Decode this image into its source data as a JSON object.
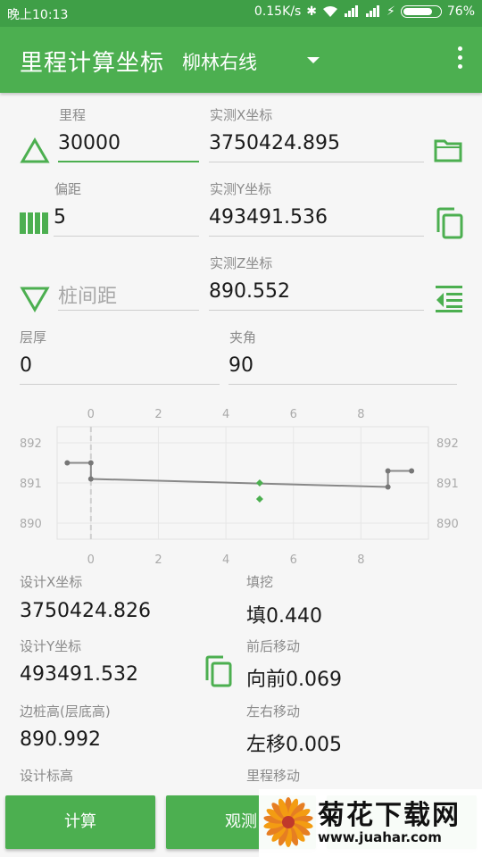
{
  "status_bar": {
    "time": "晚上10:13",
    "speed": "0.15K/s",
    "battery": "76%"
  },
  "app_bar": {
    "title": "里程计算坐标",
    "line": "柳林右线"
  },
  "fields": {
    "mileage_label": "里程",
    "mileage": "30000",
    "x_label": "实测X坐标",
    "x": "3750424.895",
    "offset_label": "偏距",
    "offset": "5",
    "y_label": "实测Y坐标",
    "y": "493491.536",
    "interval_placeholder": "桩间距",
    "z_label": "实测Z坐标",
    "z": "890.552",
    "thickness_label": "层厚",
    "thickness": "0",
    "angle_label": "夹角",
    "angle": "90"
  },
  "chart_data": {
    "type": "line",
    "x_ticks": [
      "0",
      "2",
      "4",
      "6",
      "8"
    ],
    "y_ticks": [
      "892",
      "891",
      "890"
    ],
    "xlim": [
      -1,
      10
    ],
    "ylim": [
      889.6,
      892.4
    ],
    "series": [
      {
        "values": [
          [
            -0.7,
            891.5
          ],
          [
            0,
            891.5
          ],
          [
            0,
            891.1
          ],
          [
            8.8,
            890.9
          ],
          [
            8.8,
            891.3
          ],
          [
            9.5,
            891.3
          ]
        ]
      }
    ],
    "markers": [
      [
        5,
        891.0
      ],
      [
        5,
        890.6
      ]
    ],
    "vertical_dashed_x": 0
  },
  "results": {
    "design_x_label": "设计X坐标",
    "design_x": "3750424.826",
    "fill_label": "填挖",
    "fill": "填0.440",
    "design_y_label": "设计Y坐标",
    "design_y": "493491.532",
    "fwd_label": "前后移动",
    "fwd": "向前0.069",
    "edge_label": "边桩高(层底高)",
    "edge": "890.992",
    "lr_label": "左右移动",
    "lr": "左移0.005",
    "design_elev_label": "设计标高",
    "mileage_move_label": "里程移动"
  },
  "buttons": {
    "calc": "计算",
    "observe": "观测"
  },
  "watermark": {
    "title": "菊花下载网",
    "url": "www.juahar.com"
  },
  "colors": {
    "accent": "#4caf50",
    "status_bar": "#3f9f47"
  }
}
